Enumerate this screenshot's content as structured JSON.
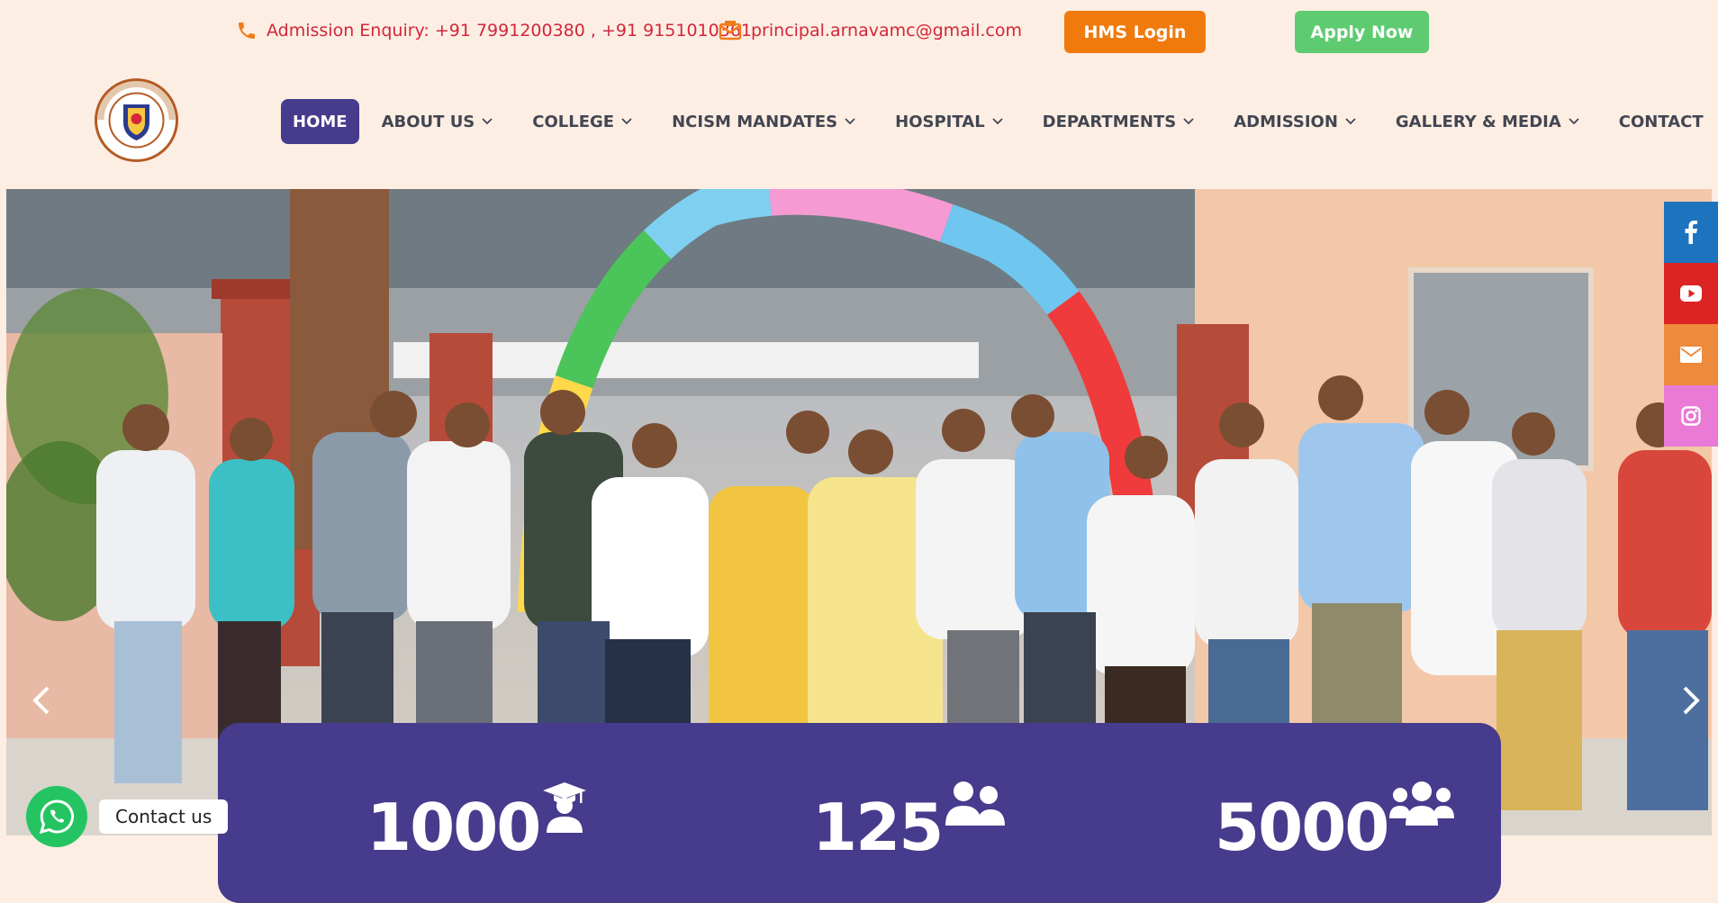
{
  "topbar": {
    "admission_enquiry": "Admission Enquiry: +91 7991200380 , +91 9151010361",
    "email": "principal.arnavamc@gmail.com",
    "hms_login": "HMS Login",
    "apply_now": "Apply Now"
  },
  "logo": {
    "top_text": "ARNAV GROUP OF INSTITUTIONS",
    "bottom_text": "BARABANKI"
  },
  "nav": {
    "items": [
      {
        "label": "HOME",
        "icon": "none"
      },
      {
        "label": "ABOUT US",
        "icon": "chevron-down-icon"
      },
      {
        "label": "COLLEGE",
        "icon": "chevron-down-icon"
      },
      {
        "label": "NCISM MANDATES",
        "icon": "chevron-down-icon"
      },
      {
        "label": "HOSPITAL",
        "icon": "chevron-down-icon"
      },
      {
        "label": "DEPARTMENTS",
        "icon": "chevron-down-icon"
      },
      {
        "label": "ADMISSION",
        "icon": "chevron-down-icon"
      },
      {
        "label": "GALLERY & MEDIA",
        "icon": "chevron-down-icon"
      },
      {
        "label": "CONTACT",
        "icon": "none"
      }
    ],
    "active": "HOME"
  },
  "hero": {
    "slide_image": "group-photo-in-front-of-building",
    "prev_icon": "chevron-left-icon",
    "next_icon": "chevron-right-icon"
  },
  "social": [
    {
      "icon": "facebook-icon",
      "color": "#1e73be"
    },
    {
      "icon": "youtube-icon",
      "color": "#dd2424"
    },
    {
      "icon": "email-icon",
      "color": "#ee8a3c"
    },
    {
      "icon": "instagram-icon",
      "color": "#e97ad6"
    }
  ],
  "stats": [
    {
      "value": "1000",
      "icon": "graduate-icon"
    },
    {
      "value": "125",
      "icon": "users-icon"
    },
    {
      "value": "5000",
      "icon": "users-group-icon"
    }
  ],
  "whatsapp": {
    "label": "Contact us",
    "icon": "whatsapp-icon",
    "color": "#25c463"
  },
  "colors": {
    "primary": "#463b8c",
    "accent_orange": "#f07a0c",
    "accent_green": "#5ecb70",
    "contact_red": "#d3263a",
    "background": "#fdeee4"
  }
}
